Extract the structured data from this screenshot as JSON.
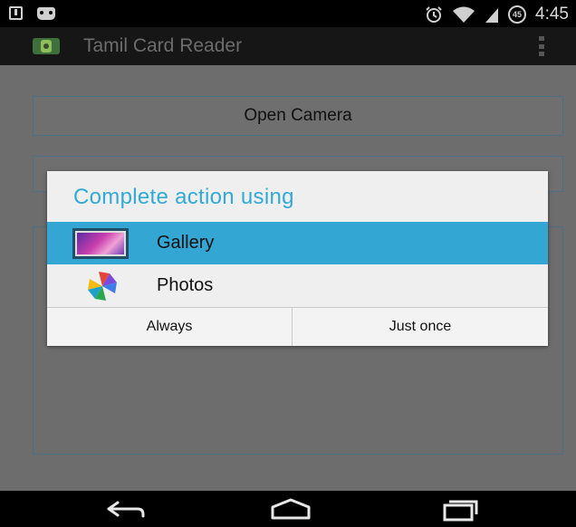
{
  "status_bar": {
    "left_icons": [
      "download-icon",
      "cat-icon"
    ],
    "right_icons": [
      "alarm-icon",
      "wifi-icon",
      "signal-icon",
      "battery-icon"
    ],
    "battery_level": "45",
    "time": "4:45"
  },
  "action_bar": {
    "app_icon": "android-app-icon",
    "title": "Tamil Card Reader",
    "overflow_icon": "overflow-menu-icon"
  },
  "main": {
    "open_camera_label": "Open Camera"
  },
  "dialog": {
    "title": "Complete action using",
    "options": [
      {
        "label": "Gallery",
        "icon": "gallery-icon",
        "selected": true
      },
      {
        "label": "Photos",
        "icon": "photos-pinwheel-icon",
        "selected": false
      }
    ],
    "always_label": "Always",
    "just_once_label": "Just once"
  },
  "nav_bar": {
    "icons": [
      "back-icon",
      "home-icon",
      "recents-icon"
    ]
  },
  "colors": {
    "accent_blue": "#33a9d6",
    "selected_row": "#34a6d3",
    "scrim_gray": "#6d6d6d",
    "dialog_bg": "#efefef"
  }
}
